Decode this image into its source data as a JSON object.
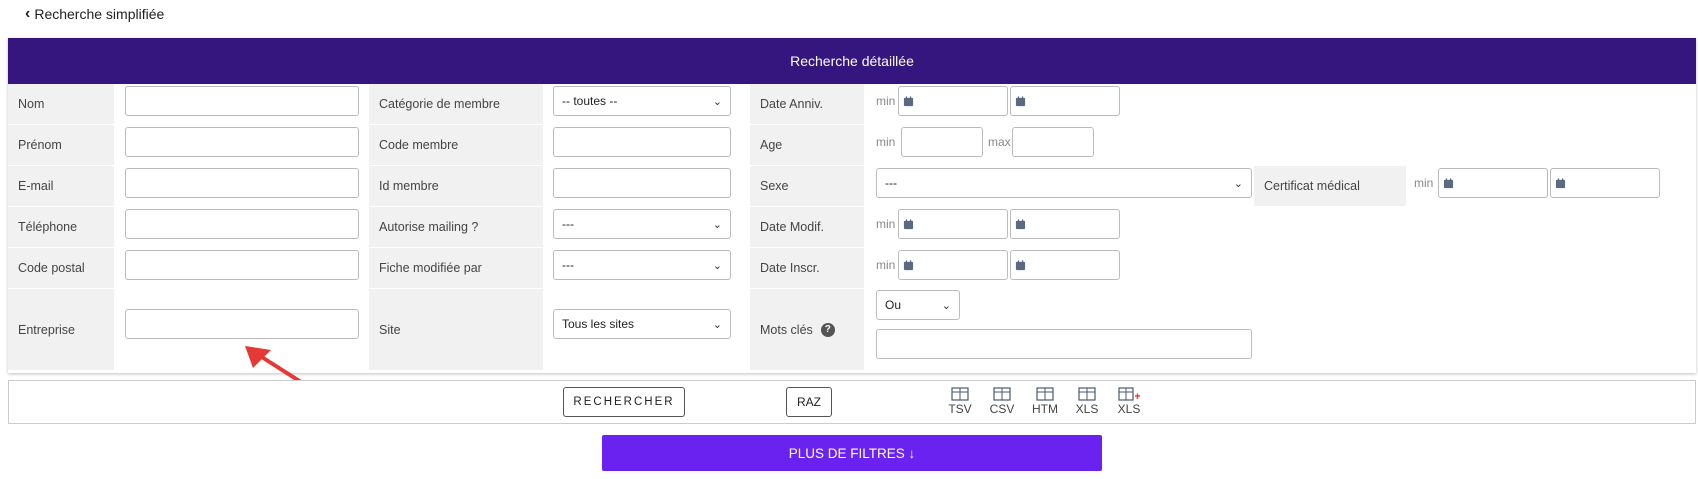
{
  "nav": {
    "back_label": "Recherche simplifiée"
  },
  "panel": {
    "title": "Recherche détaillée"
  },
  "col1": {
    "nom": "Nom",
    "prenom": "Prénom",
    "email": "E-mail",
    "telephone": "Téléphone",
    "code_postal": "Code postal",
    "entreprise": "Entreprise"
  },
  "col2": {
    "categorie": "Catégorie de membre",
    "categorie_value": "-- toutes --",
    "code_membre": "Code membre",
    "id_membre": "Id membre",
    "autorise_mailing": "Autorise mailing ?",
    "autorise_mailing_value": "---",
    "fiche_modifiee": "Fiche modifiée par",
    "fiche_modifiee_value": "---",
    "site": "Site",
    "site_value": "Tous les sites"
  },
  "col3": {
    "date_anniv": "Date Anniv.",
    "age": "Age",
    "sexe": "Sexe",
    "sexe_value": "---",
    "date_modif": "Date Modif.",
    "date_inscr": "Date Inscr.",
    "mots_cles": "Mots clés",
    "mots_cles_operator": "Ou"
  },
  "col4": {
    "certificat": "Certificat médical"
  },
  "range": {
    "min": "min",
    "max": "max"
  },
  "toolbar": {
    "search": "RECHERCHER",
    "reset": "RAZ",
    "exports": [
      "TSV",
      "CSV",
      "HTM",
      "XLS",
      "XLS"
    ]
  },
  "more_filters": "PLUS DE FILTRES ↓",
  "colors": {
    "header": "#35157e",
    "accent": "#6a22f0",
    "label_bg": "#f1f1f1",
    "arrow": "#e53935"
  },
  "icons": [
    "chevron-left-icon",
    "calendar-icon",
    "help-icon",
    "table-icon",
    "table-add-icon",
    "arrow-down-icon"
  ]
}
